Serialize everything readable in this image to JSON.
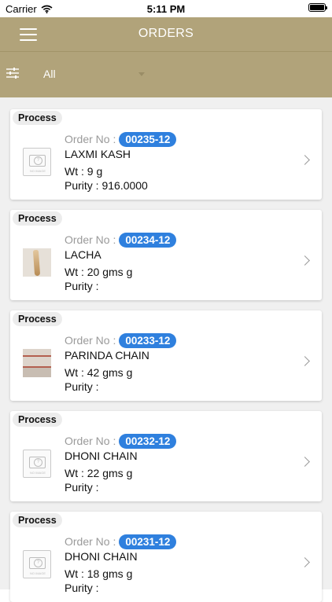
{
  "status_bar": {
    "carrier": "Carrier",
    "time": "5:11 PM"
  },
  "header": {
    "title": "ORDERS"
  },
  "filter": {
    "selected": "All"
  },
  "orders": [
    {
      "status": "Process",
      "order_label": "Order No :",
      "order_no": "00235-12",
      "name": "LAXMI KASH",
      "weight": "Wt : 9 g",
      "purity": "Purity : 916.0000",
      "image": "no-image"
    },
    {
      "status": "Process",
      "order_label": "Order No :",
      "order_no": "00234-12",
      "name": "LACHA",
      "weight": "Wt : 20 gms g",
      "purity": "Purity :",
      "image": "photo"
    },
    {
      "status": "Process",
      "order_label": "Order No :",
      "order_no": "00233-12",
      "name": "PARINDA CHAIN",
      "weight": "Wt : 42 gms g",
      "purity": "Purity :",
      "image": "photo"
    },
    {
      "status": "Process",
      "order_label": "Order No :",
      "order_no": "00232-12",
      "name": "DHONI CHAIN",
      "weight": "Wt : 22 gms g",
      "purity": "Purity :",
      "image": "no-image"
    },
    {
      "status": "Process",
      "order_label": "Order No :",
      "order_no": "00231-12",
      "name": "DHONI CHAIN",
      "weight": "Wt : 18 gms g",
      "purity": "Purity :",
      "image": "no-image"
    }
  ],
  "no_image_text": "NO IMAGE",
  "colors": {
    "header_bg": "#b1a37a",
    "badge_bg": "#2f80de",
    "list_bg": "#f0f0f0"
  },
  "icons": {
    "menu": "hamburger-icon",
    "filter": "sliders-icon",
    "dropdown": "caret-down-icon",
    "row": "chevron-right-icon",
    "placeholder": "camera-placeholder-icon"
  }
}
